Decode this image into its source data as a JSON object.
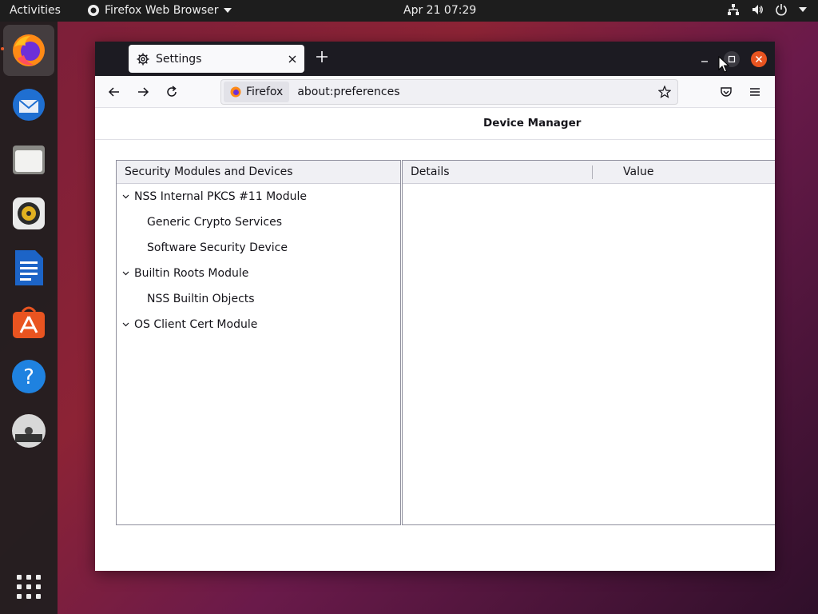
{
  "topbar": {
    "activities": "Activities",
    "app_menu": "Firefox Web Browser",
    "clock": "Apr 21  07:29"
  },
  "dock": {
    "items": [
      "firefox",
      "thunderbird",
      "files",
      "rhythmbox",
      "libreoffice-writer",
      "ubuntu-software",
      "help",
      "dvd",
      "show-applications"
    ]
  },
  "browser": {
    "tab_title": "Settings",
    "identity_label": "Firefox",
    "url": "about:preferences"
  },
  "dialog": {
    "title": "Device Manager",
    "tree_header": "Security Modules and Devices",
    "tree": [
      {
        "label": "NSS Internal PKCS #11 Module",
        "level": 0
      },
      {
        "label": "Generic Crypto Services",
        "level": 1
      },
      {
        "label": "Software Security Device",
        "level": 1
      },
      {
        "label": "Builtin Roots Module",
        "level": 0
      },
      {
        "label": "NSS Builtin Objects",
        "level": 1
      },
      {
        "label": "OS Client Cert Module",
        "level": 0
      }
    ],
    "details_header": "Details",
    "value_header": "Value"
  },
  "colors": {
    "ubuntu_orange": "#e95420",
    "tabstrip": "#1c1b22"
  }
}
